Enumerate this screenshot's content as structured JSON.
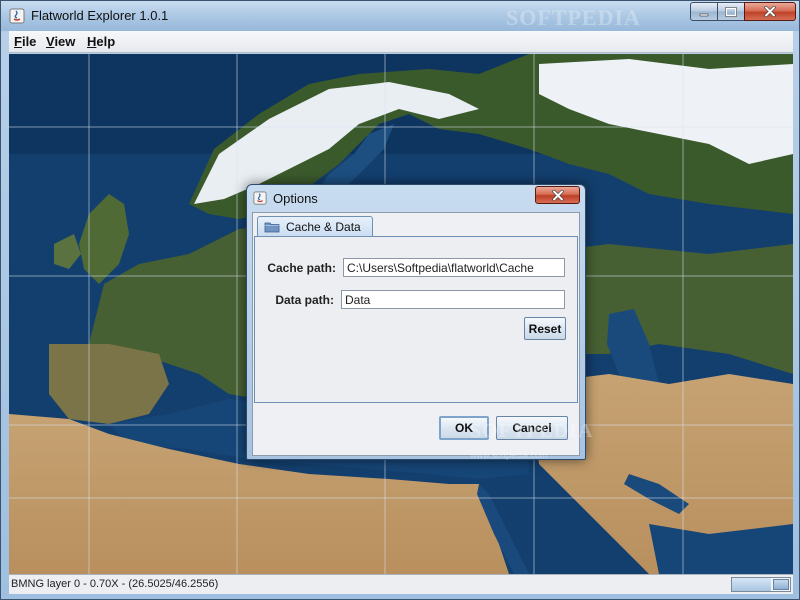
{
  "window": {
    "title": "Flatworld Explorer 1.0.1",
    "watermark": "SOFTPEDIA",
    "controls": {
      "minimize": "minimize-icon",
      "maximize": "maximize-icon",
      "close": "close-icon"
    }
  },
  "menu": {
    "items": [
      {
        "label": "File",
        "mnemonic": "F",
        "rest": "ile"
      },
      {
        "label": "View",
        "mnemonic": "V",
        "rest": "iew"
      },
      {
        "label": "Help",
        "mnemonic": "H",
        "rest": "elp"
      }
    ]
  },
  "status": {
    "text": "BMNG layer 0 - 0.70X - (26.5025/46.2556)",
    "progress": 0.67
  },
  "dialog": {
    "title": "Options",
    "tab": "Cache & Data",
    "cache_label": "Cache path:",
    "cache_value": "C:\\Users\\Softpedia\\flatworld\\Cache",
    "data_label": "Data path:",
    "data_value": "Data",
    "reset_label": "Reset",
    "ok_label": "OK",
    "cancel_label": "Cancel",
    "watermark": "SOFTPEDIA",
    "watermark_small": "www.softpedia.com"
  },
  "colors": {
    "ocean": "#123e6c",
    "land_green": "#3d5a2a",
    "desert": "#c9a577",
    "snow": "#f2f4f7",
    "grid": "#d9e3ee"
  }
}
